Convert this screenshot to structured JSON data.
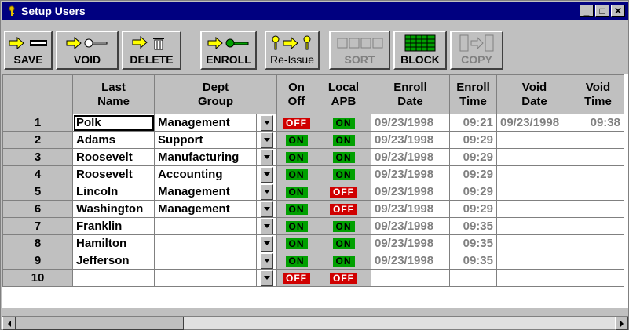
{
  "window": {
    "title": "Setup Users",
    "buttons": [
      "_",
      "□",
      "✕"
    ]
  },
  "toolbar": {
    "save": "SAVE",
    "void": "VOID",
    "delete": "DELETE",
    "enroll": "ENROLL",
    "reissue": "Re-Issue",
    "sort": "SORT",
    "block": "BLOCK",
    "copy": "COPY"
  },
  "columns": [
    {
      "line1": "Last",
      "line2": "Name"
    },
    {
      "line1": "Dept",
      "line2": "Group"
    },
    {
      "line1": "On",
      "line2": "Off"
    },
    {
      "line1": "Local",
      "line2": "APB"
    },
    {
      "line1": "Enroll",
      "line2": "Date"
    },
    {
      "line1": "Enroll",
      "line2": "Time"
    },
    {
      "line1": "Void",
      "line2": "Date"
    },
    {
      "line1": "Void",
      "line2": "Time"
    }
  ],
  "rows": [
    {
      "num": "1",
      "last": "Polk",
      "dept": "Management",
      "onoff": "OFF",
      "apb": "ON",
      "edate": "09/23/1998",
      "etime": "09:21",
      "vdate": "09/23/1998",
      "vtime": "09:38"
    },
    {
      "num": "2",
      "last": "Adams",
      "dept": "Support",
      "onoff": "ON",
      "apb": "ON",
      "edate": "09/23/1998",
      "etime": "09:29",
      "vdate": "",
      "vtime": ""
    },
    {
      "num": "3",
      "last": "Roosevelt",
      "dept": "Manufacturing",
      "onoff": "ON",
      "apb": "ON",
      "edate": "09/23/1998",
      "etime": "09:29",
      "vdate": "",
      "vtime": ""
    },
    {
      "num": "4",
      "last": "Roosevelt",
      "dept": "Accounting",
      "onoff": "ON",
      "apb": "ON",
      "edate": "09/23/1998",
      "etime": "09:29",
      "vdate": "",
      "vtime": ""
    },
    {
      "num": "5",
      "last": "Lincoln",
      "dept": "Management",
      "onoff": "ON",
      "apb": "OFF",
      "edate": "09/23/1998",
      "etime": "09:29",
      "vdate": "",
      "vtime": ""
    },
    {
      "num": "6",
      "last": "Washington",
      "dept": "Management",
      "onoff": "ON",
      "apb": "OFF",
      "edate": "09/23/1998",
      "etime": "09:29",
      "vdate": "",
      "vtime": ""
    },
    {
      "num": "7",
      "last": "Franklin",
      "dept": "",
      "onoff": "ON",
      "apb": "ON",
      "edate": "09/23/1998",
      "etime": "09:35",
      "vdate": "",
      "vtime": ""
    },
    {
      "num": "8",
      "last": "Hamilton",
      "dept": "",
      "onoff": "ON",
      "apb": "ON",
      "edate": "09/23/1998",
      "etime": "09:35",
      "vdate": "",
      "vtime": ""
    },
    {
      "num": "9",
      "last": "Jefferson",
      "dept": "",
      "onoff": "ON",
      "apb": "ON",
      "edate": "09/23/1998",
      "etime": "09:35",
      "vdate": "",
      "vtime": ""
    },
    {
      "num": "10",
      "last": "",
      "dept": "",
      "onoff": "OFF",
      "apb": "OFF",
      "edate": "",
      "etime": "",
      "vdate": "",
      "vtime": ""
    }
  ],
  "colors": {
    "titlebar": "#000080",
    "on": "#00a000",
    "off": "#d00000",
    "face": "#c0c0c0"
  }
}
